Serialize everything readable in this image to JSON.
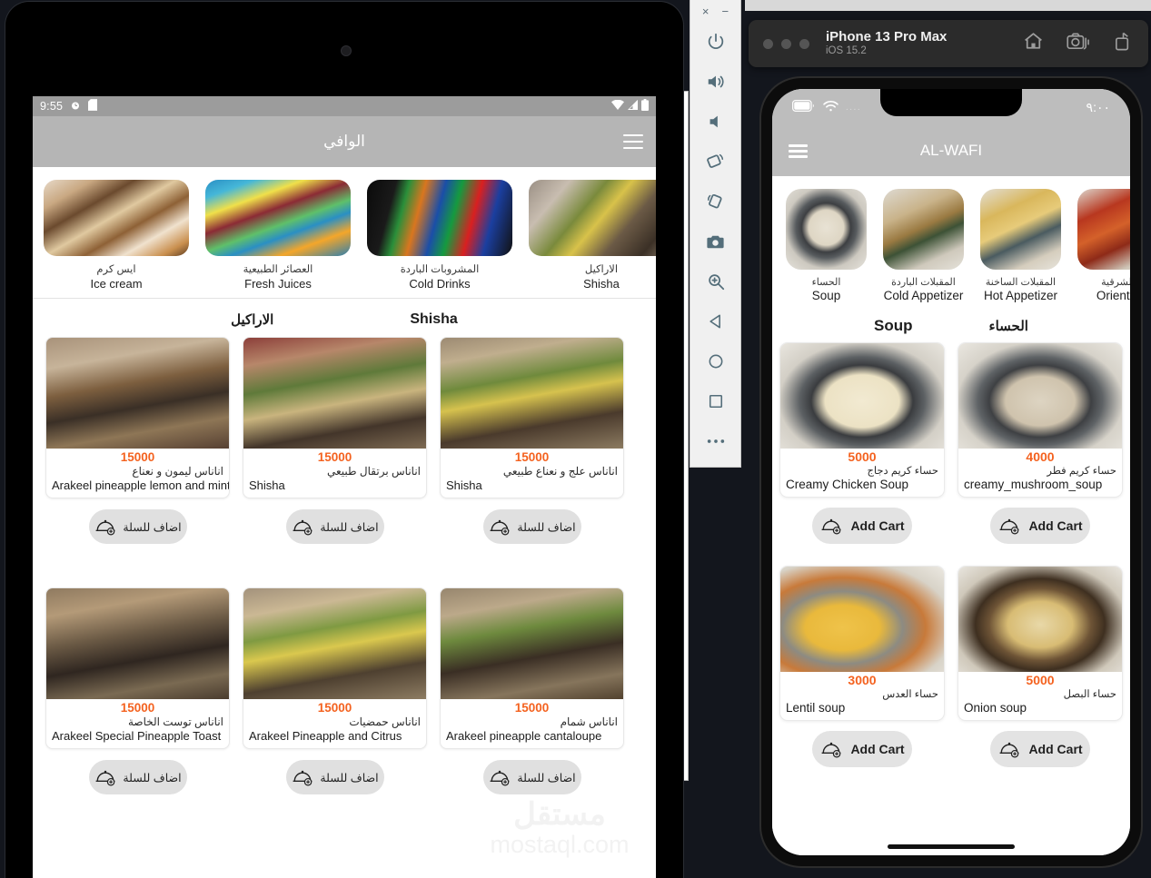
{
  "android": {
    "status_bar": {
      "time": "9:55",
      "icons": [
        "alarm-icon",
        "sd-card-icon",
        "wifi-icon",
        "signal-icon",
        "battery-icon"
      ]
    },
    "app_bar": {
      "title": "الوافي",
      "menu_icon": "hamburger-menu-icon"
    },
    "categories": [
      {
        "ar": "ايس كرم",
        "en": "Ice cream"
      },
      {
        "ar": "العصائر الطبيعية",
        "en": "Fresh Juices"
      },
      {
        "ar": "المشروبات الباردة",
        "en": "Cold Drinks"
      },
      {
        "ar": "الاراكيل",
        "en": "Shisha"
      }
    ],
    "section": {
      "ar": "الاراكيل",
      "en": "Shisha"
    },
    "add_to_cart_label": "اضاف للسلة",
    "products": [
      {
        "price": "15000",
        "ar": "اناناس ليمون و نعناع",
        "en": "Arakeel pineapple lemon and mint"
      },
      {
        "price": "15000",
        "ar": "اناناس برتقال طبيعي",
        "en": "Shisha"
      },
      {
        "price": "15000",
        "ar": "اناناس علج و نعناع طبيعي",
        "en": "Shisha"
      },
      {
        "price": "15000",
        "ar": "اناناس توست الخاصة",
        "en": "Arakeel Special Pineapple Toast"
      },
      {
        "price": "15000",
        "ar": "اناناس حمضيات",
        "en": "Arakeel Pineapple and Citrus"
      },
      {
        "price": "15000",
        "ar": "اناناس شمام",
        "en": "Arakeel pineapple cantaloupe"
      }
    ],
    "watermark": {
      "ar": "مستقل",
      "en": "mostaql.com"
    }
  },
  "emulator_toolbar": {
    "close_label": "×",
    "minimize_label": "−",
    "buttons": [
      "power-icon",
      "volume-up-icon",
      "volume-down-icon",
      "rotate-left-icon",
      "rotate-right-icon",
      "screenshot-camera-icon",
      "zoom-in-icon",
      "back-triangle-icon",
      "home-circle-icon",
      "overview-square-icon",
      "more-options-icon"
    ]
  },
  "ios": {
    "toolbar": {
      "device_name": "iPhone 13 Pro Max",
      "os_version": "iOS 15.2",
      "icons": [
        "home-icon",
        "screenshot-camera-icon",
        "share-icon"
      ]
    },
    "status_bar": {
      "time": "٩:٠٠",
      "icons": [
        "battery-icon",
        "wifi-icon"
      ],
      "dots": "...."
    },
    "app_bar": {
      "title": "AL-WAFI",
      "menu_icon": "hamburger-menu-icon"
    },
    "categories": [
      {
        "ar": "الحساء",
        "en": "Soup"
      },
      {
        "ar": "المقبلات الباردة",
        "en": "Cold Appetizer"
      },
      {
        "ar": "المقبلات الساخنة",
        "en": "Hot Appetizer"
      },
      {
        "ar": "الشرقية",
        "en": "Oriental"
      }
    ],
    "section": {
      "en": "Soup",
      "ar": "الحساء"
    },
    "add_to_cart_label": "Add Cart",
    "products": [
      {
        "price": "5000",
        "ar": "حساء كريم دجاج",
        "en": "Creamy Chicken Soup"
      },
      {
        "price": "4000",
        "ar": "حساء كريم فطر",
        "en": "creamy_mushroom_soup"
      },
      {
        "price": "3000",
        "ar": "حساء العدس",
        "en": "Lentil soup"
      },
      {
        "price": "5000",
        "ar": "حساء البصل",
        "en": "Onion soup"
      }
    ]
  },
  "colors": {
    "price_orange": "#f4621f",
    "app_bar_android": "#b5b5b5",
    "app_bar_ios": "#bdbdbd",
    "add_button_bg": "#e0e0e0"
  }
}
